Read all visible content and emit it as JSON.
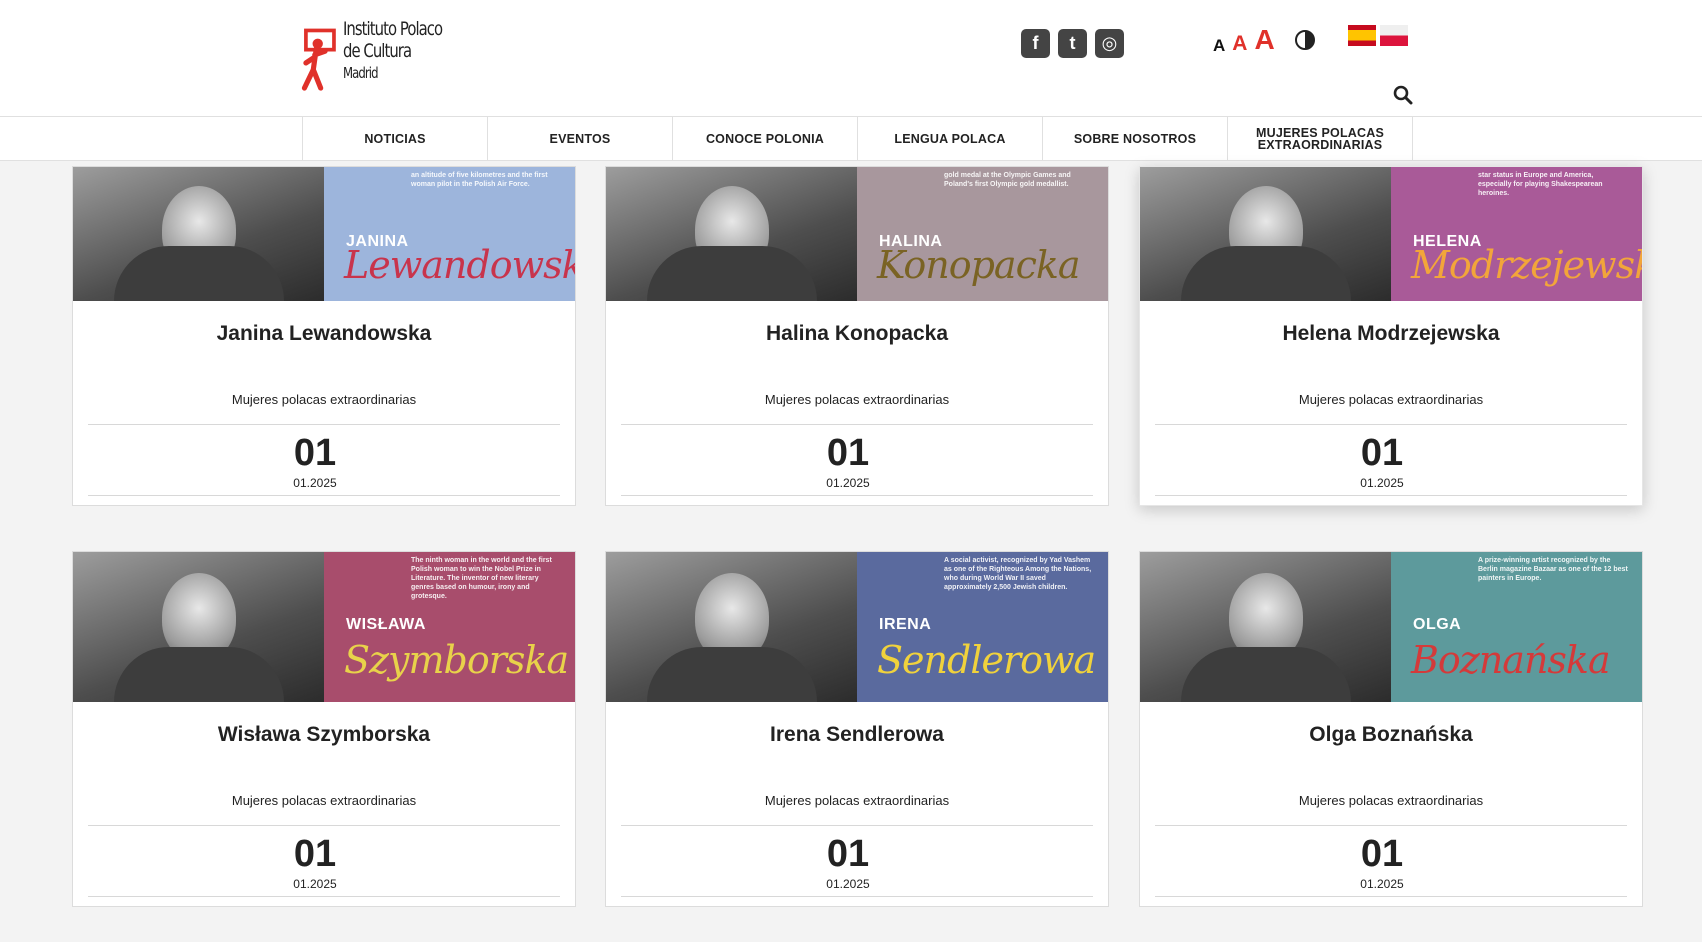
{
  "header": {
    "logo": {
      "line1": "Instituto Polaco",
      "line2": "de Cultura",
      "line3": "Madrid"
    },
    "social": [
      {
        "name": "facebook-icon",
        "glyph": "f"
      },
      {
        "name": "twitter-icon",
        "glyph": "t"
      },
      {
        "name": "instagram-icon",
        "glyph": "◎"
      }
    ],
    "font_sizes": [
      "A",
      "A",
      "A"
    ],
    "languages": [
      "es",
      "pl"
    ]
  },
  "nav": {
    "items": [
      "NOTICIAS",
      "EVENTOS",
      "CONOCE POLONIA",
      "LENGUA POLACA",
      "SOBRE NOSOTROS",
      "MUJERES POLACAS EXTRAORDINARIAS"
    ]
  },
  "cards": [
    {
      "title": "Janina Lewandowska",
      "category": "Mujeres polacas extraordinarias",
      "day": "01",
      "date": "01.2025",
      "img_first": "JANINA",
      "img_last": "Lewandowska",
      "img_blurb": "an altitude of five kilometres and the first woman pilot in the Polish Air Force.",
      "panel_color": "#9db5dc",
      "last_color": "#c8344c"
    },
    {
      "title": "Halina Konopacka",
      "category": "Mujeres polacas extraordinarias",
      "day": "01",
      "date": "01.2025",
      "img_first": "HALINA",
      "img_last": "Konopacka",
      "img_blurb": "gold medal at the Olympic Games and Poland's first Olympic gold medallist.",
      "panel_color": "#a8979d",
      "last_color": "#7a6324"
    },
    {
      "title": "Helena Modrzejewska",
      "category": "Mujeres polacas extraordinarias",
      "day": "01",
      "date": "01.2025",
      "img_first": "HELENA",
      "img_last": "Modrzejewska",
      "img_blurb": "star status in Europe and America, especially for playing Shakespearean heroines.",
      "panel_color": "#a95a98",
      "last_color": "#f2a53a"
    },
    {
      "title": "Wisława Szymborska",
      "category": "Mujeres polacas extraordinarias",
      "day": "01",
      "date": "01.2025",
      "img_first": "WISŁAWA",
      "img_last": "Szymborska",
      "img_blurb": "The ninth woman in the world and the first Polish woman to win the Nobel Prize in Literature. The inventor of new literary genres based on humour, irony and grotesque.",
      "panel_color": "#a84d6c",
      "last_color": "#e8d24a"
    },
    {
      "title": "Irena Sendlerowa",
      "category": "Mujeres polacas extraordinarias",
      "day": "01",
      "date": "01.2025",
      "img_first": "IRENA",
      "img_last": "Sendlerowa",
      "img_blurb": "A social activist, recognized by Yad Vashem as one of the Righteous Among the Nations, who during World War II saved approximately 2,500 Jewish children.",
      "panel_color": "#5a6a9e",
      "last_color": "#f0d23c"
    },
    {
      "title": "Olga Boznańska",
      "category": "Mujeres polacas extraordinarias",
      "day": "01",
      "date": "01.2025",
      "img_first": "OLGA",
      "img_last": "Boznańska",
      "img_blurb": "A prize-winning artist recognized by the Berlin magazine Bazaar as one of the 12 best painters in Europe.",
      "panel_color": "#5d9a9c",
      "last_color": "#d43a3a"
    }
  ]
}
